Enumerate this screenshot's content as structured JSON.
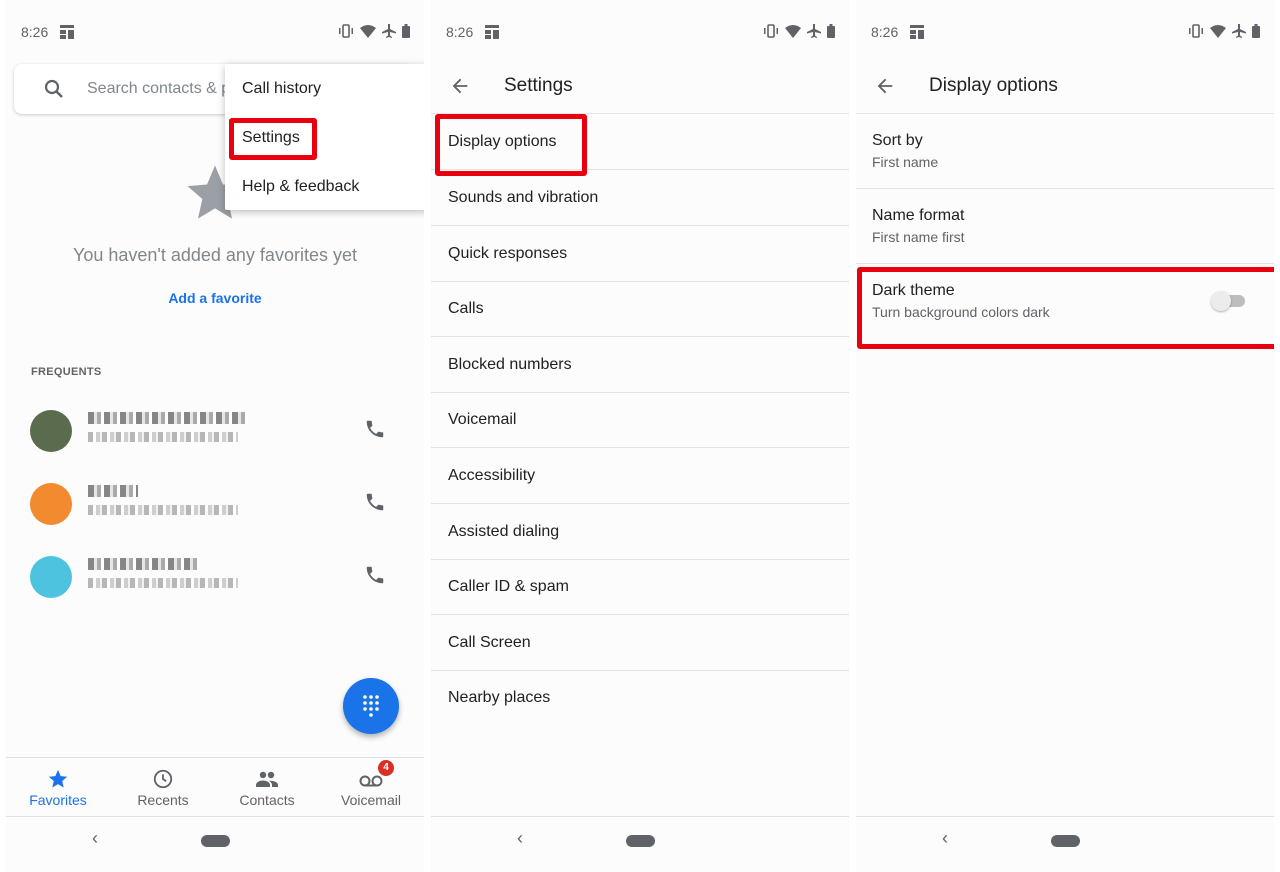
{
  "status_bar": {
    "time": "8:26"
  },
  "favorites_screen": {
    "search_placeholder": "Search contacts & p",
    "overflow_menu": {
      "items": [
        {
          "label": "Call history"
        },
        {
          "label": "Settings",
          "highlighted": true
        },
        {
          "label": "Help & feedback"
        }
      ]
    },
    "empty_message": "You haven't added any favorites yet",
    "add_favorite": "Add a favorite",
    "frequents_header": "FREQUENTS",
    "frequents": [
      {
        "name": "[blurred name]",
        "number": "[blurred number]",
        "avatar_color": "#5b6b4e"
      },
      {
        "name": "[blurred name]",
        "number": "[blurred number]",
        "avatar_color": "#f28b30"
      },
      {
        "name": "[blurred name]",
        "number": "[blurred number]",
        "avatar_color": "#4ec3e0"
      }
    ],
    "bottom_tabs": [
      {
        "label": "Favorites",
        "icon": "star-icon",
        "active": true
      },
      {
        "label": "Recents",
        "icon": "clock-icon"
      },
      {
        "label": "Contacts",
        "icon": "people-icon"
      },
      {
        "label": "Voicemail",
        "icon": "voicemail-icon",
        "badge": "4"
      }
    ]
  },
  "settings_screen": {
    "title": "Settings",
    "items": [
      {
        "label": "Display options",
        "highlighted": true
      },
      {
        "label": "Sounds and vibration"
      },
      {
        "label": "Quick responses"
      },
      {
        "label": "Calls"
      },
      {
        "label": "Blocked numbers"
      },
      {
        "label": "Voicemail"
      },
      {
        "label": "Accessibility"
      },
      {
        "label": "Assisted dialing"
      },
      {
        "label": "Caller ID & spam"
      },
      {
        "label": "Call Screen"
      },
      {
        "label": "Nearby places"
      }
    ]
  },
  "display_options_screen": {
    "title": "Display options",
    "items": [
      {
        "title": "Sort by",
        "subtitle": "First name"
      },
      {
        "title": "Name format",
        "subtitle": "First name first"
      },
      {
        "title": "Dark theme",
        "subtitle": "Turn background colors dark",
        "toggle": false,
        "highlighted": true
      }
    ]
  },
  "colors": {
    "accent": "#1a73e8",
    "highlight_box": "#e8000f",
    "badge": "#d93025"
  }
}
